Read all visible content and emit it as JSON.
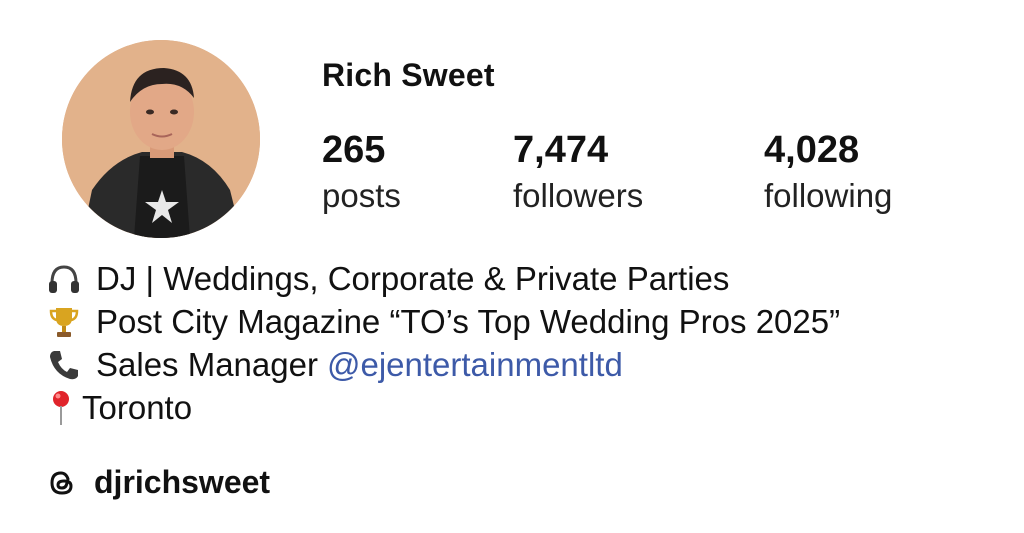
{
  "profile": {
    "name": "Rich Sweet",
    "avatar_icon": "profile-photo-avatar"
  },
  "stats": {
    "posts": {
      "count": "265",
      "label": "posts"
    },
    "followers": {
      "count": "7,474",
      "label": "followers"
    },
    "following": {
      "count": "4,028",
      "label": "following"
    }
  },
  "bio": {
    "line1": {
      "icon": "headphones-icon",
      "text": "DJ | Weddings, Corporate & Private Parties"
    },
    "line2": {
      "icon": "trophy-icon",
      "text": "Post City Magazine “TO’s Top Wedding Pros 2025”"
    },
    "line3": {
      "icon": "telephone-icon",
      "text": "Sales Manager",
      "mention": "@ejentertainmentltd"
    },
    "line4": {
      "icon": "map-pin-icon",
      "text": "Toronto"
    }
  },
  "threads": {
    "icon": "threads-icon",
    "handle": "djrichsweet"
  },
  "colors": {
    "mention": "#3d5aa8",
    "text": "#111111",
    "background": "#ffffff"
  }
}
